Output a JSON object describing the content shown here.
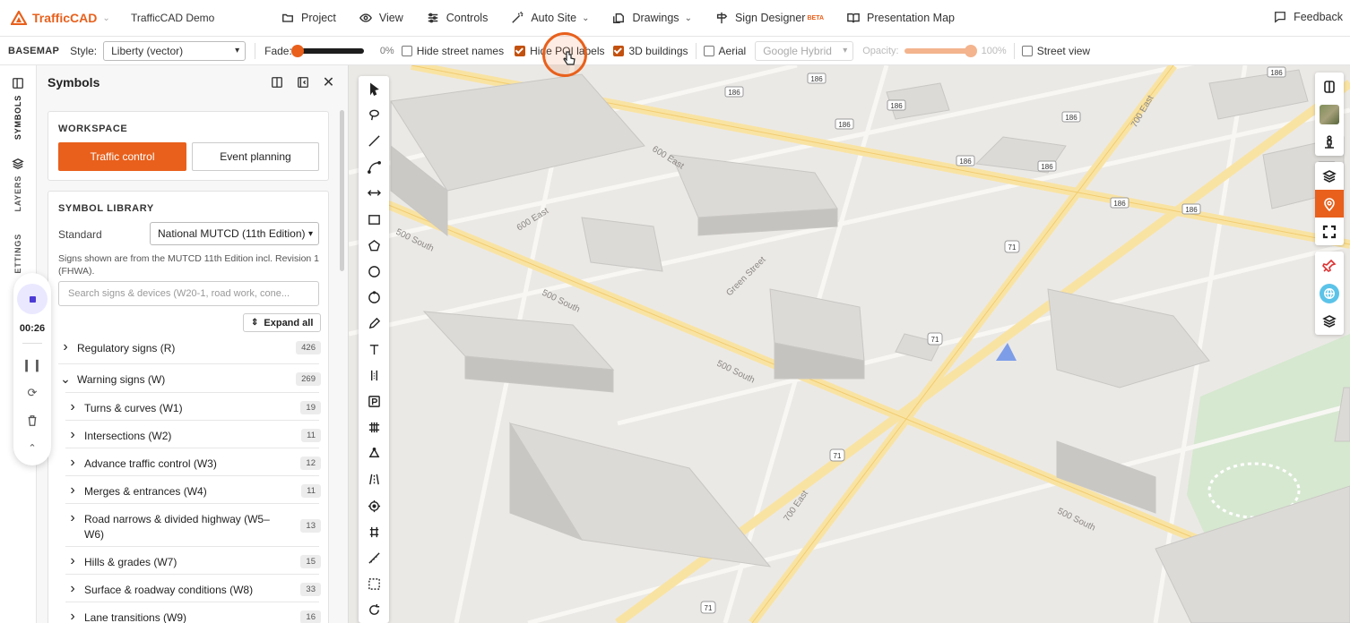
{
  "app": {
    "name": "TrafficCAD",
    "project": "TrafficCAD Demo",
    "brand_color": "#e8601c"
  },
  "nav": [
    {
      "label": "Project",
      "icon": "folder-icon",
      "dropdown": false
    },
    {
      "label": "View",
      "icon": "eye-icon",
      "dropdown": false
    },
    {
      "label": "Controls",
      "icon": "sliders-icon",
      "dropdown": false
    },
    {
      "label": "Auto Site",
      "icon": "magic-wand-icon",
      "dropdown": true
    },
    {
      "label": "Drawings",
      "icon": "drawings-icon",
      "dropdown": true
    },
    {
      "label": "Sign Designer",
      "icon": "signpost-icon",
      "dropdown": false,
      "badge": "BETA"
    },
    {
      "label": "Presentation Map",
      "icon": "book-open-icon",
      "dropdown": false
    }
  ],
  "feedback": {
    "label": "Feedback"
  },
  "basemap": {
    "title": "BASEMAP",
    "style_label": "Style:",
    "style_value": "Liberty (vector)",
    "fade_label": "Fade:",
    "fade_value": "0%",
    "fade_fraction": 0.0,
    "hide_street_names": {
      "label": "Hide street names",
      "checked": false
    },
    "hide_poi_labels": {
      "label": "Hide POI labels",
      "checked": true
    },
    "buildings_3d": {
      "label": "3D buildings",
      "checked": true
    },
    "aerial": {
      "label": "Aerial",
      "checked": false
    },
    "aerial_source": "Google Hybrid",
    "opacity_label": "Opacity:",
    "opacity_value": "100%",
    "opacity_fraction": 1.0,
    "street_view": {
      "label": "Street view",
      "checked": false
    }
  },
  "rail": {
    "symbols": "SYMBOLS",
    "layers": "LAYERS",
    "settings": "SETTINGS"
  },
  "recorder": {
    "time": "00:26"
  },
  "panel": {
    "title": "Symbols",
    "workspace": {
      "title": "WORKSPACE",
      "active": "Traffic control",
      "other": "Event planning"
    },
    "library": {
      "title": "SYMBOL LIBRARY",
      "standard_label": "Standard",
      "standard_value": "National MUTCD (11th Edition)",
      "note": "Signs shown are from the MUTCD 11th Edition incl. Revision 1 (FHWA).",
      "search_placeholder": "Search signs & devices (W20-1, road work, cone...",
      "expand_all": "Expand all",
      "categories": [
        {
          "label": "Regulatory signs (R)",
          "count": "426",
          "expanded": false,
          "level": 0
        },
        {
          "label": "Warning signs (W)",
          "count": "269",
          "expanded": true,
          "level": 0
        },
        {
          "label": "Turns & curves (W1)",
          "count": "19",
          "expanded": false,
          "level": 1
        },
        {
          "label": "Intersections (W2)",
          "count": "11",
          "expanded": false,
          "level": 1
        },
        {
          "label": "Advance traffic control (W3)",
          "count": "12",
          "expanded": false,
          "level": 1
        },
        {
          "label": "Merges & entrances (W4)",
          "count": "11",
          "expanded": false,
          "level": 1
        },
        {
          "label": "Road narrows & divided highway (W5–W6)",
          "count": "13",
          "expanded": false,
          "level": 1
        },
        {
          "label": "Hills & grades (W7)",
          "count": "15",
          "expanded": false,
          "level": 1
        },
        {
          "label": "Surface & roadway conditions (W8)",
          "count": "33",
          "expanded": false,
          "level": 1
        },
        {
          "label": "Lane transitions (W9)",
          "count": "16",
          "expanded": false,
          "level": 1
        }
      ]
    }
  },
  "map": {
    "street_labels": [
      "500 South",
      "500 South",
      "500 South",
      "500 South",
      "600 East",
      "600 East",
      "700 East",
      "700 East",
      "Green Street"
    ],
    "route_shields": [
      "186",
      "186",
      "186",
      "186",
      "186",
      "186",
      "186",
      "186",
      "186",
      "186",
      "186",
      "71",
      "71",
      "71",
      "71"
    ]
  },
  "draw_tools": [
    "select-arrow-icon",
    "lasso-icon",
    "line-icon",
    "curve-icon",
    "dimension-icon",
    "rectangle-icon",
    "polygon-icon",
    "circle-icon",
    "ellipse-icon",
    "pencil-icon",
    "text-icon",
    "sign-icon",
    "parking-icon",
    "crosswalk-icon",
    "vertex-icon",
    "road-icon",
    "target-icon",
    "rail-icon",
    "measure-icon",
    "select-area-icon",
    "rotate-icon"
  ],
  "map_controls": [
    "split-view-icon",
    "aerial-thumbnail-icon",
    "street-view-pegman-icon",
    "layers-icon",
    "location-pin-icon",
    "fullscreen-icon",
    "pin-icon",
    "globe-icon",
    "layer-stack-icon"
  ]
}
